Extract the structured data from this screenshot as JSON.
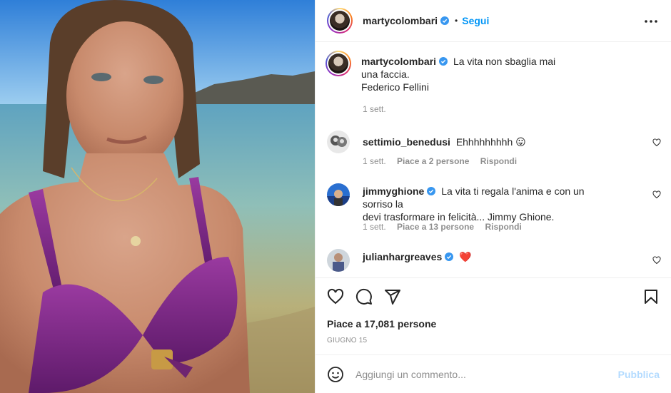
{
  "post": {
    "username": "martycolombari",
    "follow_label": "Segui",
    "separator": "•",
    "caption_line1": "La vita non sbaglia mai",
    "caption_line2": "una faccia.",
    "caption_line3": "Federico Fellini",
    "caption_time": "1 sett."
  },
  "comments": [
    {
      "username": "settimio_benedusi",
      "text": "Ehhhhhhhhh",
      "emoji": "😛",
      "time": "1 sett.",
      "likes": "Piace a 2 persone",
      "reply": "Rispondi"
    },
    {
      "username": "jimmyghione",
      "text_line1": "La vita ti regala l'anima e con un sorriso la",
      "text_line2": "devi trasformare in felicità... Jimmy Ghione.",
      "time": "1 sett.",
      "likes": "Piace a 13 persone",
      "reply": "Rispondi"
    },
    {
      "username": "julianhargreaves",
      "emoji": "❤️"
    }
  ],
  "footer": {
    "likes": "Piace a 17,081 persone",
    "date": "GIUGNO 15",
    "comment_placeholder": "Aggiungi un commento...",
    "publish_label": "Pubblica"
  },
  "colors": {
    "link_blue": "#0095f6",
    "verified_blue": "#3897f0",
    "muted": "#8e8e8e",
    "publish_disabled": "#b3dbff"
  },
  "icons": [
    "verified-icon",
    "more-options-icon",
    "heart-icon",
    "comment-icon",
    "share-icon",
    "bookmark-icon",
    "emoji-icon"
  ]
}
